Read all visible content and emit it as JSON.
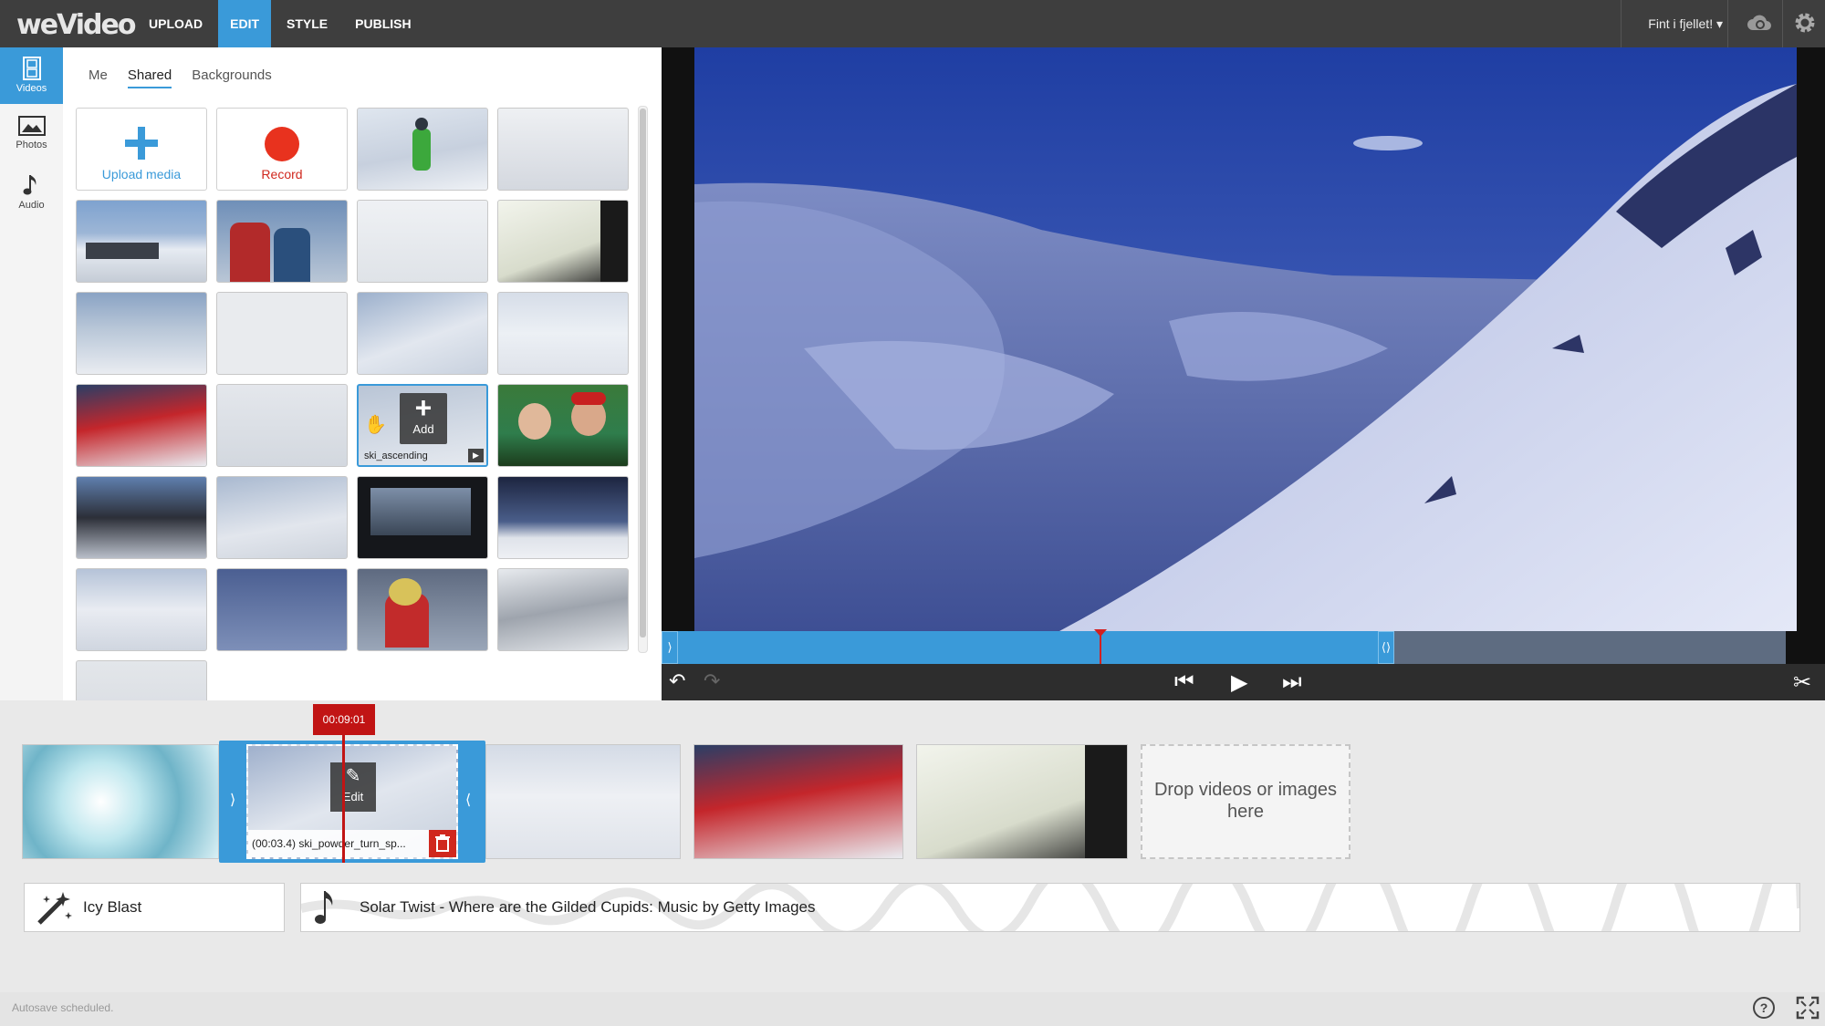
{
  "app": {
    "logo": "weVideo"
  },
  "nav": [
    {
      "label": "UPLOAD",
      "active": false
    },
    {
      "label": "EDIT",
      "active": true
    },
    {
      "label": "STYLE",
      "active": false
    },
    {
      "label": "PUBLISH",
      "active": false
    }
  ],
  "header": {
    "project_name": "Fint i fjellet! ▾",
    "cloud_icon": "cloud-sync-icon",
    "settings_icon": "gear-icon"
  },
  "sidebar": {
    "items": [
      {
        "label": "Videos",
        "icon": "film-icon",
        "active": true
      },
      {
        "label": "Photos",
        "icon": "image-icon",
        "active": false
      },
      {
        "label": "Audio",
        "icon": "music-note-icon",
        "active": false
      }
    ]
  },
  "media": {
    "tabs": [
      {
        "label": "Me",
        "active": false
      },
      {
        "label": "Shared",
        "active": true
      },
      {
        "label": "Backgrounds",
        "active": false
      }
    ],
    "upload_label": "Upload media",
    "record_label": "Record",
    "hover_tile": {
      "add_label": "Add",
      "caption": "ski_ascending"
    }
  },
  "preview": {
    "colors": {
      "accent": "#3a9ad9",
      "playhead": "#d32020"
    }
  },
  "timeline": {
    "playhead_time": "00:09:01",
    "selected_clip": {
      "caption": "(00:03.4) ski_powder_turn_sp...",
      "edit_label": "Edit"
    },
    "drop_zone": "Drop videos or images here",
    "theme": {
      "label": "Icy Blast"
    },
    "music": {
      "label": "Solar Twist - Where are the Gilded Cupids: Music by Getty Images"
    }
  },
  "status": {
    "text": "Autosave scheduled."
  }
}
